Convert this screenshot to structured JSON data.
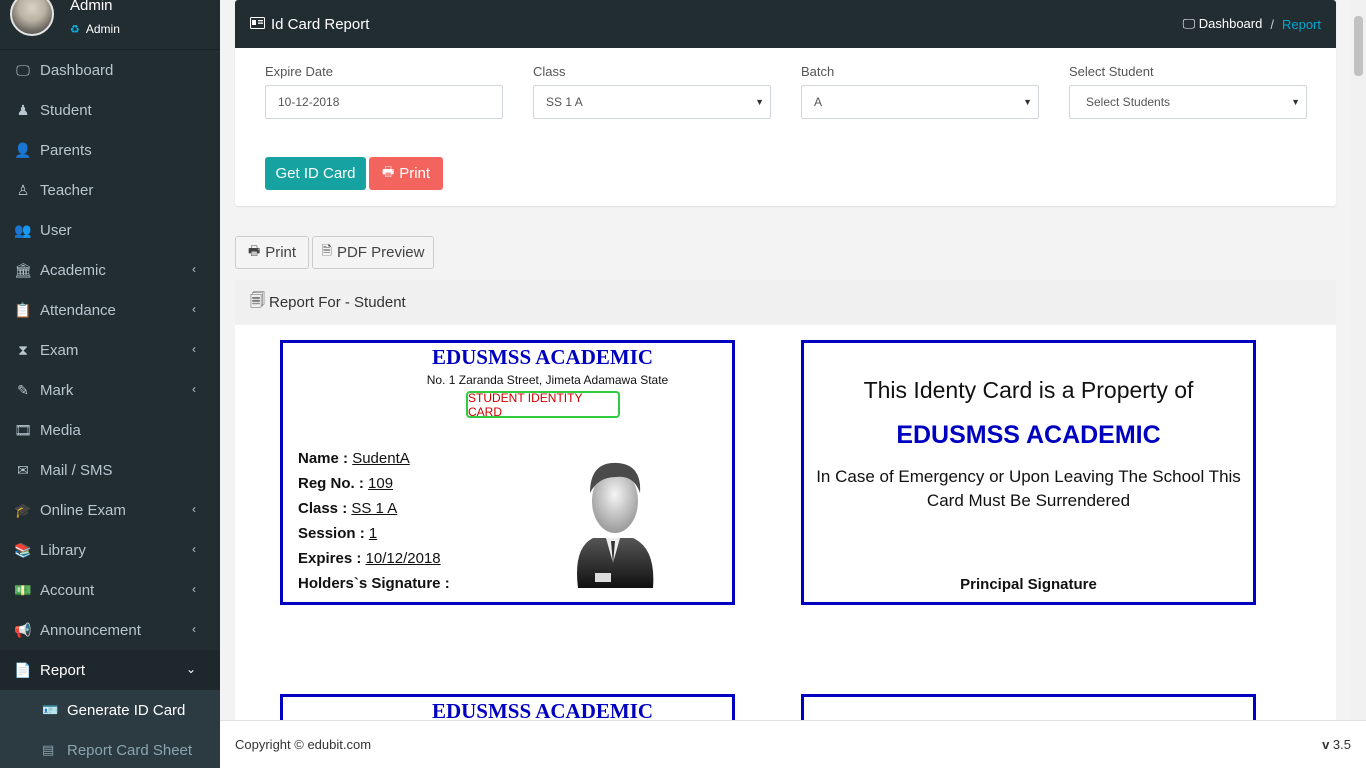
{
  "user": {
    "name": "Admin",
    "role": "Admin"
  },
  "sidebar": {
    "items": [
      {
        "label": "Dashboard",
        "icon": "laptop-icon",
        "glyph": "🖵",
        "chevron": false
      },
      {
        "label": "Student",
        "icon": "student-icon",
        "glyph": "♟",
        "chevron": false
      },
      {
        "label": "Parents",
        "icon": "user-icon",
        "glyph": "👤",
        "chevron": false
      },
      {
        "label": "Teacher",
        "icon": "teacher-icon",
        "glyph": "♙",
        "chevron": false
      },
      {
        "label": "User",
        "icon": "users-icon",
        "glyph": "👥",
        "chevron": false
      },
      {
        "label": "Academic",
        "icon": "bank-icon",
        "glyph": "🏛",
        "chevron": true
      },
      {
        "label": "Attendance",
        "icon": "clipboard-icon",
        "glyph": "📋",
        "chevron": true
      },
      {
        "label": "Exam",
        "icon": "hourglass-icon",
        "glyph": "⧗",
        "chevron": true
      },
      {
        "label": "Mark",
        "icon": "edit-icon",
        "glyph": "✎",
        "chevron": true
      },
      {
        "label": "Media",
        "icon": "film-icon",
        "glyph": "🎞",
        "chevron": false
      },
      {
        "label": "Mail / SMS",
        "icon": "envelope-icon",
        "glyph": "✉",
        "chevron": false
      },
      {
        "label": "Online Exam",
        "icon": "graduation-cap-icon",
        "glyph": "🎓",
        "chevron": true
      },
      {
        "label": "Library",
        "icon": "books-icon",
        "glyph": "📚",
        "chevron": true
      },
      {
        "label": "Account",
        "icon": "money-icon",
        "glyph": "💵",
        "chevron": true
      },
      {
        "label": "Announcement",
        "icon": "bullhorn-icon",
        "glyph": "📢",
        "chevron": true
      },
      {
        "label": "Report",
        "icon": "report-icon",
        "glyph": "📄",
        "chevron": true
      }
    ],
    "sub_items": [
      {
        "label": "Generate ID Card",
        "icon": "id-card-icon",
        "glyph": "🪪"
      },
      {
        "label": "Report Card Sheet",
        "icon": "table-icon",
        "glyph": "▤"
      }
    ]
  },
  "header": {
    "title": "Id Card Report",
    "breadcrumb_home": "Dashboard",
    "breadcrumb_sep": "/",
    "breadcrumb_active": "Report"
  },
  "form": {
    "expire_label": "Expire Date",
    "expire_value": "10-12-2018",
    "class_label": "Class",
    "class_value": "SS 1 A",
    "batch_label": "Batch",
    "batch_value": "A",
    "student_label": "Select Student",
    "student_value": "Select Students"
  },
  "buttons": {
    "get_id_card": "Get ID Card",
    "print": "Print",
    "tool_print": "Print",
    "pdf_preview": "PDF Preview"
  },
  "report": {
    "header": "Report For - Student"
  },
  "card_front": {
    "school": "EDUSMSS ACADEMIC",
    "address": "No. 1 Zaranda Street, Jimeta Adamawa State",
    "badge": "STUDENT IDENTITY CARD",
    "name_label": "Name :",
    "name_value": "SudentA",
    "reg_label": "Reg No. :",
    "reg_value": "109",
    "class_label": "Class :",
    "class_value": "SS 1 A",
    "session_label": "Session :",
    "session_value": "1",
    "expires_label": "Expires :",
    "expires_value": "10/12/2018",
    "signature_label": "Holders`s Signature :"
  },
  "card_back": {
    "title": "This Identy Card is a Property of",
    "school": "EDUSMSS ACADEMIC",
    "note": "In Case of Emergency or Upon Leaving The School This Card Must Be Surrendered",
    "sign": "Principal Signature"
  },
  "footer": {
    "copyright": "Copyright © edubit.com",
    "version_prefix": "v",
    "version": "3.5"
  },
  "colors": {
    "sidebar_bg": "#222d32",
    "card_border": "#0000c0",
    "get_btn": "#17a2a2",
    "print_btn": "#f4645f"
  }
}
